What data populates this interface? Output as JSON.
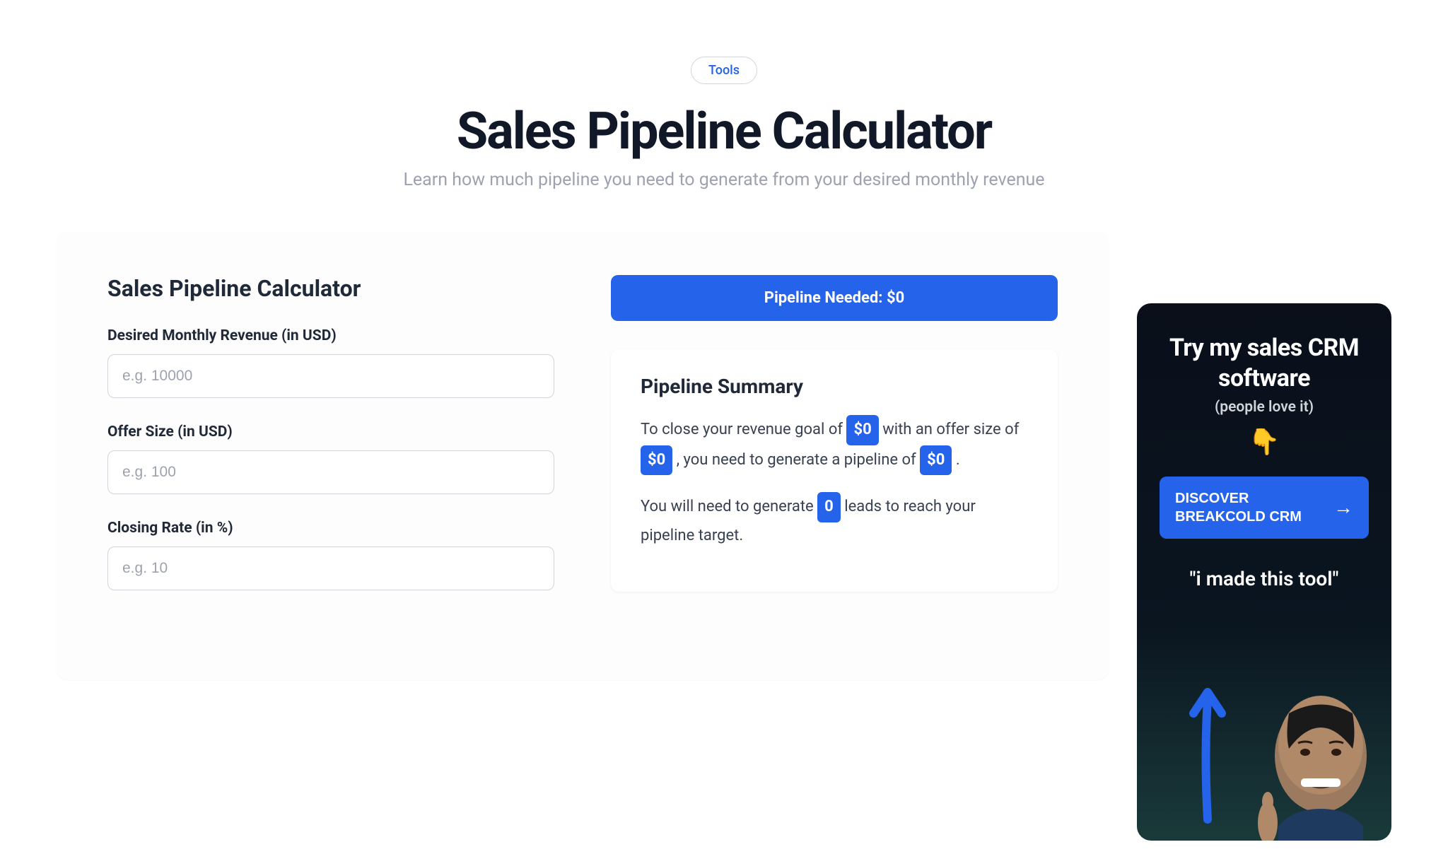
{
  "header": {
    "badge": "Tools",
    "title": "Sales Pipeline Calculator",
    "subtitle": "Learn how much pipeline you need to generate from your desired monthly revenue"
  },
  "form": {
    "title": "Sales Pipeline Calculator",
    "revenue": {
      "label": "Desired Monthly Revenue (in USD)",
      "placeholder": "e.g. 10000"
    },
    "offer": {
      "label": "Offer Size (in USD)",
      "placeholder": "e.g. 100"
    },
    "closing": {
      "label": "Closing Rate (in %)",
      "placeholder": "e.g. 10"
    }
  },
  "results": {
    "pipeline_needed_label": "Pipeline Needed: ",
    "pipeline_needed_value": "$0",
    "summary_title": "Pipeline Summary",
    "text1_part1": "To close your revenue goal of ",
    "revenue_value": "$0",
    "text1_part2": " with an offer size of ",
    "offer_value": "$0",
    "text1_part3": " , you need to generate a pipeline of ",
    "pipeline_value": "$0",
    "text1_part4": " .",
    "text2_part1": "You will need to generate ",
    "leads_value": "0",
    "text2_part2": " leads to reach your pipeline target."
  },
  "sidebar": {
    "title": "Try my sales CRM software",
    "subtitle": "(people love it)",
    "emoji": "👇",
    "button_text": "DISCOVER BREAKCOLD CRM",
    "arrow": "→",
    "quote": "\"i made this tool\""
  }
}
